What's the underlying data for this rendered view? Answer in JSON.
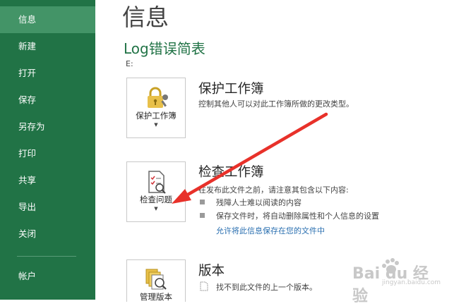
{
  "sidebar": {
    "items": [
      {
        "label": "信息",
        "active": true
      },
      {
        "label": "新建"
      },
      {
        "label": "打开"
      },
      {
        "label": "保存"
      },
      {
        "label": "另存为"
      },
      {
        "label": "打印"
      },
      {
        "label": "共享"
      },
      {
        "label": "导出"
      },
      {
        "label": "关闭"
      }
    ],
    "account_label": "帐户"
  },
  "main": {
    "title": "信息",
    "file_name": "Log错误简表",
    "file_path": "E:",
    "protect": {
      "tile_label": "保护工作簿",
      "title": "保护工作簿",
      "description": "控制其他人可以对此工作簿所做的更改类型。"
    },
    "inspect": {
      "tile_label": "检查问题",
      "title": "检查工作簿",
      "description": "在发布此文件之前，请注意其包含以下内容:",
      "bullets": [
        "残障人士难以阅读的内容",
        "保存文件时，将自动删除属性和个人信息的设置"
      ],
      "link": "允许将此信息保存在您的文件中"
    },
    "versions": {
      "tile_label": "管理版本",
      "title": "版本",
      "description": "找不到此文件的上一个版本。"
    }
  },
  "watermark": {
    "text": "Bai du 经验",
    "subtext": "jingyan.baidu.com"
  },
  "colors": {
    "sidebar": "#217346",
    "sidebar_active": "#439467",
    "accent_green": "#217346",
    "link": "#2a6fb0",
    "arrow": "#e8312a"
  },
  "icons": [
    "lock-key-icon",
    "inspect-document-icon",
    "manage-versions-icon",
    "document-icon"
  ]
}
